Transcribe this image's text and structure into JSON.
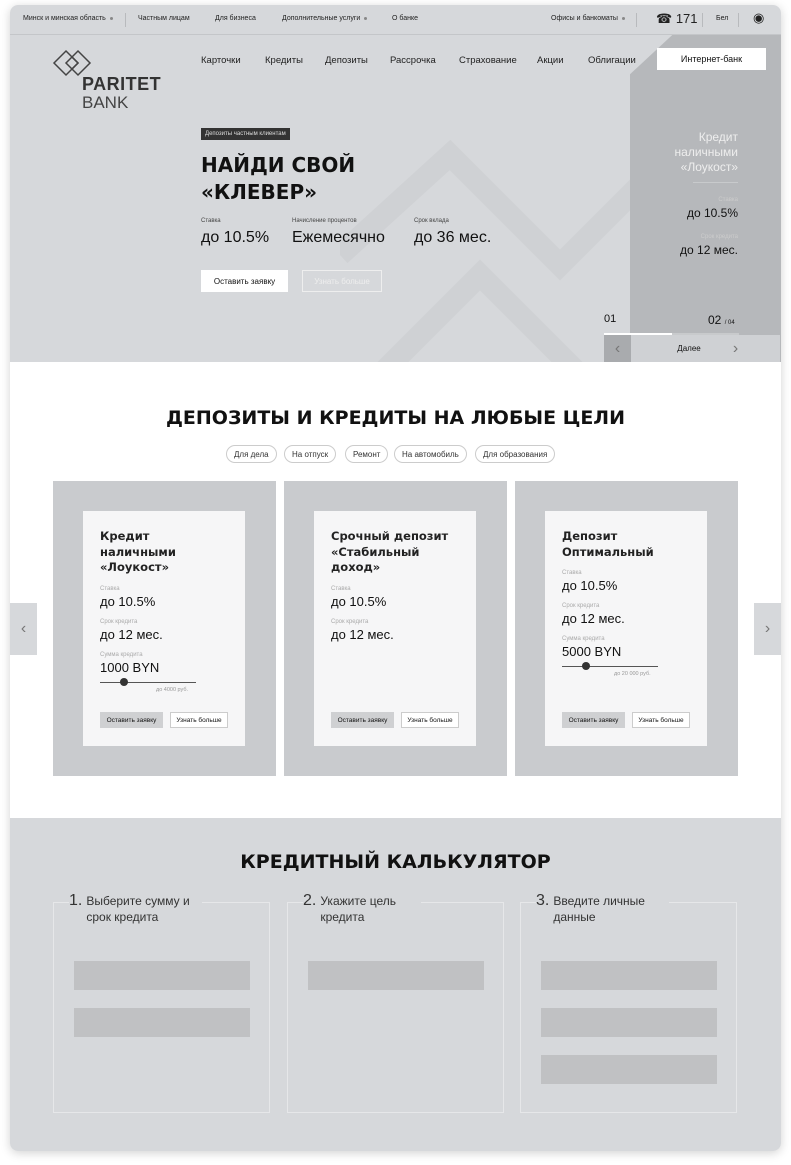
{
  "topbar": {
    "region": "Минск и минская область",
    "private": "Частным лицам",
    "business": "Для бизнеса",
    "services": "Дополнительные услуги",
    "about": "О банке",
    "offices": "Офисы и банкоматы",
    "phone": "171",
    "lang": "Бел"
  },
  "logo": {
    "line1": "PARITET",
    "line2": "BANK"
  },
  "nav": [
    "Карточки",
    "Кредиты",
    "Депозиты",
    "Рассрочка",
    "Страхование",
    "Акции",
    "Облигации"
  ],
  "internet_bank": "Интернет-банк",
  "hero": {
    "badge": "Депозиты частным клиентам",
    "title1": "НАЙДИ СВОЙ",
    "title2": "«КЛЕВЕР»",
    "stats": [
      {
        "label": "Ставка",
        "value": "до 10.5%"
      },
      {
        "label": "Начисление процентов",
        "value": "Ежемесячно"
      },
      {
        "label": "Срок вклада",
        "value": "до 36 мес."
      }
    ],
    "apply": "Оставить заявку",
    "more": "Узнать больше"
  },
  "side": {
    "title": "Кредит наличными «Лоукост»",
    "rate_label": "Ставка",
    "rate": "до 10.5%",
    "term_label": "Срок кредита",
    "term": "до 12 мес.",
    "current": "01",
    "next": "02",
    "total": "/ 04",
    "next_label": "Далее",
    "progress": 0.5
  },
  "section": {
    "title": "ДЕПОЗИТЫ И КРЕДИТЫ НА ЛЮБЫЕ ЦЕЛИ",
    "chips": [
      "Для дела",
      "На отпуск",
      "Ремонт",
      "На автомобиль",
      "Для образования"
    ]
  },
  "cards": [
    {
      "title": "Кредит наличными «Лоукост»",
      "rate_label": "Ставка",
      "rate": "до 10.5%",
      "term_label": "Срок кредита",
      "term": "до 12 мес.",
      "sum_label": "Сумма кредита",
      "sum": "1000 BYN",
      "max": "до 4000 руб.",
      "slider": 0.25,
      "apply": "Оставить заявку",
      "more": "Узнать больше"
    },
    {
      "title": "Срочный депозит «Стабильный доход»",
      "rate_label": "Ставка",
      "rate": "до 10.5%",
      "term_label": "Срок кредита",
      "term": "до 12 мес.",
      "apply": "Оставить заявку",
      "more": "Узнать больше"
    },
    {
      "title": "Депозит Оптимальный",
      "rate_label": "Ставка",
      "rate": "до 10.5%",
      "term_label": "Срок кредита",
      "term": "до 12 мес.",
      "sum_label": "Сумма кредита",
      "sum": "5000 BYN",
      "max": "до 20 000 руб.",
      "slider": 0.25,
      "apply": "Оставить заявку",
      "more": "Узнать больше"
    }
  ],
  "calc": {
    "title": "КРЕДИТНЫЙ КАЛЬКУЛЯТОР",
    "steps": [
      {
        "n": "1.",
        "text": "Выберите сумму и срок кредита"
      },
      {
        "n": "2.",
        "text": "Укажите цель кредита"
      },
      {
        "n": "3.",
        "text": "Введите личные данные"
      }
    ]
  },
  "colors": {
    "bg": "#d6d8db",
    "panel": "#b6b8bb",
    "dark": "#333333"
  }
}
